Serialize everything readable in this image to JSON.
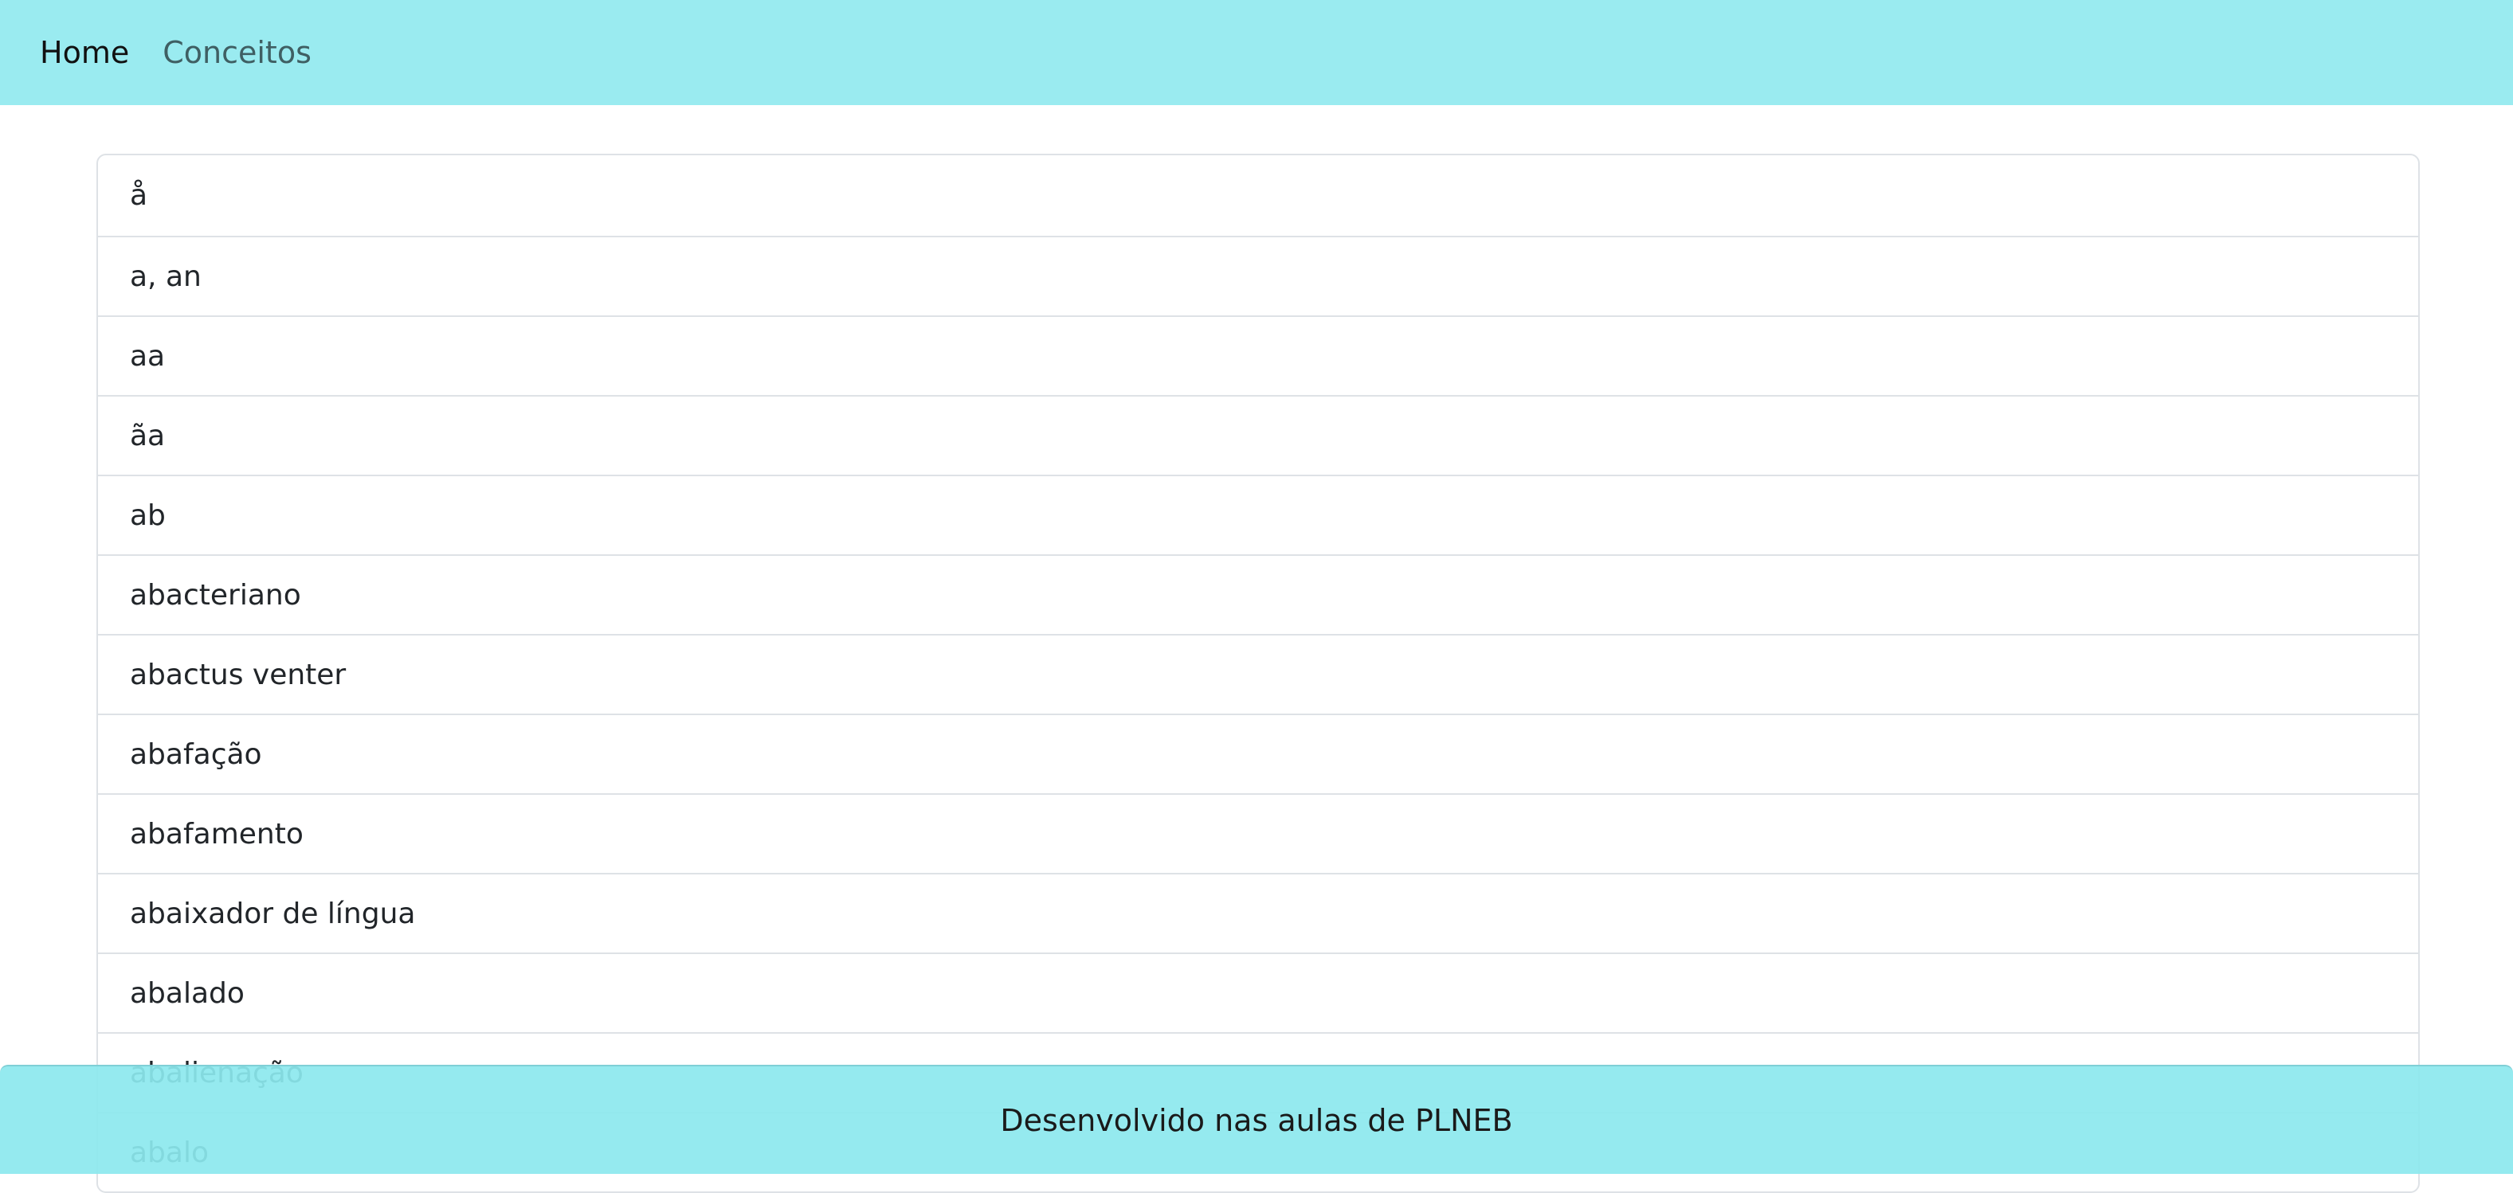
{
  "nav": {
    "home_label": "Home",
    "conceitos_label": "Conceitos"
  },
  "terms": [
    "å",
    "a, an",
    "aa",
    "ãa",
    "ab",
    "abacteriano",
    "abactus venter",
    "abafação",
    "abafamento",
    "abaixador de língua",
    "abalado",
    "abalienação",
    "abalo"
  ],
  "footer": {
    "text": "Desenvolvido nas aulas de PLNEB"
  },
  "colors": {
    "navbar_bg": "#9aebf0",
    "footer_bg": "#8ce8ee"
  }
}
